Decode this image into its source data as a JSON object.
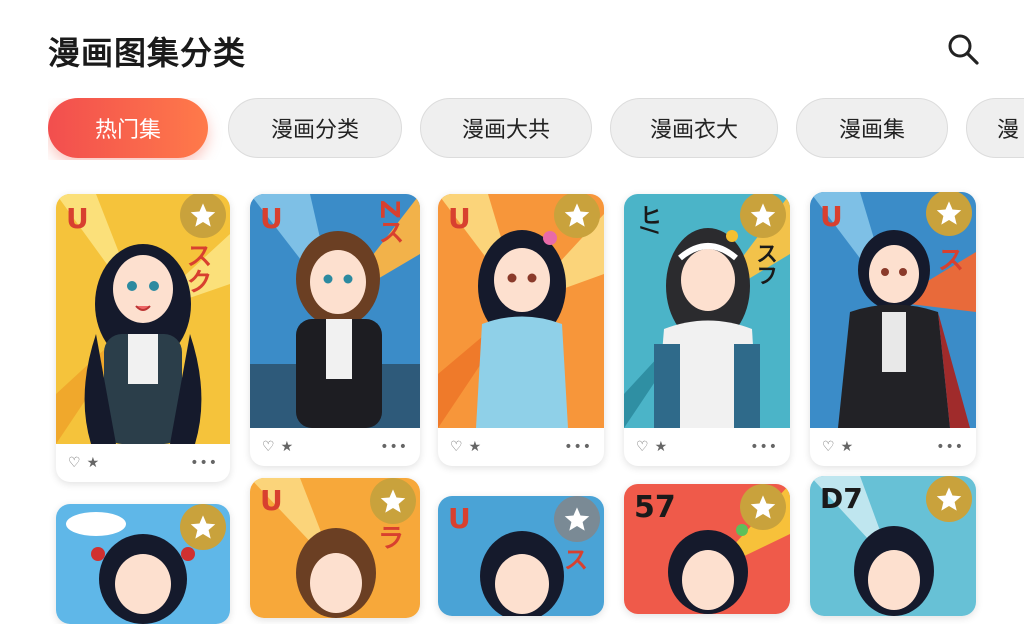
{
  "header": {
    "title": "漫画图集分类"
  },
  "tabs": [
    {
      "label": "热门集",
      "active": true
    },
    {
      "label": "漫画分类"
    },
    {
      "label": "漫画大共"
    },
    {
      "label": "漫画衣大"
    },
    {
      "label": "漫画集"
    },
    {
      "label": "漫"
    }
  ],
  "cards": [
    {
      "glyph_top": "U",
      "glyph_side": "スク",
      "bg": "#f7c13a",
      "badge_color": "#c9a23c"
    },
    {
      "glyph_top": "U",
      "glyph_side": "Zス",
      "bg": "#3d8ec9",
      "badge_color": null
    },
    {
      "glyph_top": "U",
      "glyph_side": "",
      "bg": "#f79a3a",
      "badge_color": "#c9a23c"
    },
    {
      "glyph_top": "ヒ/",
      "glyph_side": "スフ",
      "bg": "#4db6c9",
      "badge_color": "#c9a23c"
    },
    {
      "glyph_top": "U",
      "glyph_side": "ス",
      "bg": "#3d8ec9",
      "badge_color": "#c9a23c"
    },
    {
      "glyph_top": "",
      "glyph_side": "",
      "bg": "#5fb7e8",
      "badge_color": "#c9a23c"
    },
    {
      "glyph_top": "U",
      "glyph_side": "ラ",
      "bg": "#f7a83a",
      "badge_color": "#c9a23c"
    },
    {
      "glyph_top": "U",
      "glyph_side": "ス",
      "bg": "#4aa3d6",
      "badge_color": "#7a8a95"
    },
    {
      "glyph_top": "57",
      "glyph_side": "",
      "bg": "#ef5a4a",
      "badge_color": "#c9a23c"
    },
    {
      "glyph_top": "D7",
      "glyph_side": "",
      "bg": "#67c1d6",
      "badge_color": "#c9a23c"
    }
  ],
  "footer": {
    "more": "•••"
  },
  "icons": {
    "search": "search-icon",
    "star": "star-icon",
    "like": "heart-icon",
    "more": "more-dots-icon"
  }
}
